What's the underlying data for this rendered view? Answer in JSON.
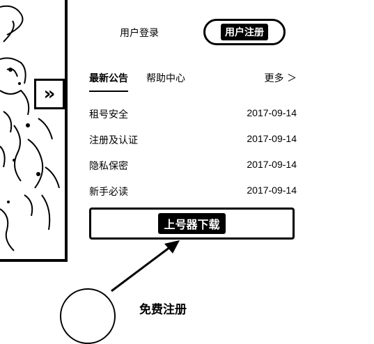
{
  "tabs": {
    "login": "用户登录",
    "register": "用户注册"
  },
  "banner": {
    "next_icon": "chevron-right-icon",
    "next_glyph": "»"
  },
  "notice": {
    "tabs": [
      "最新公告",
      "帮助中心"
    ],
    "more": "更多 ＞",
    "items": [
      {
        "title": "租号安全",
        "date": "2017-09-14"
      },
      {
        "title": "注册及认证",
        "date": "2017-09-14"
      },
      {
        "title": "隐私保密",
        "date": "2017-09-14"
      },
      {
        "title": "新手必读",
        "date": "2017-09-14"
      }
    ]
  },
  "download": {
    "label": "上号器下载"
  },
  "free_register": {
    "label": "免费注册"
  }
}
